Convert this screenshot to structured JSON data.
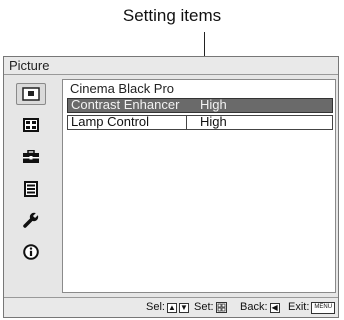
{
  "callout": {
    "text": "Setting items"
  },
  "menu": {
    "title": "Picture",
    "sidebar": [
      {
        "icon": "picture-icon",
        "active": true
      },
      {
        "icon": "screen-icon",
        "active": false
      },
      {
        "icon": "toolbox-icon",
        "active": false
      },
      {
        "icon": "list-icon",
        "active": false
      },
      {
        "icon": "wrench-icon",
        "active": false
      },
      {
        "icon": "info-icon",
        "active": false
      }
    ],
    "items": [
      {
        "label": "Cinema Black Pro",
        "value": ""
      },
      {
        "label": "Contrast Enhancer",
        "value": "High"
      },
      {
        "label": "Lamp Control",
        "value": "High"
      }
    ],
    "status": {
      "sel_label": "Sel:",
      "set_label": "Set:",
      "back_label": "Back:",
      "exit_label": "Exit:",
      "menu_key": "MENU"
    }
  }
}
